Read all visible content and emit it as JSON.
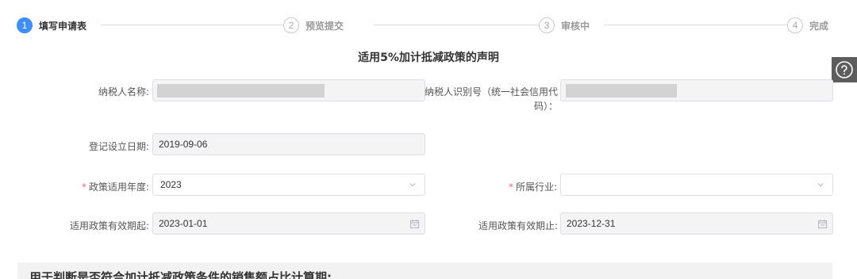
{
  "steps": [
    {
      "num": "1",
      "label": "填写申请表"
    },
    {
      "num": "2",
      "label": "预览提交"
    },
    {
      "num": "3",
      "label": "审核中"
    },
    {
      "num": "4",
      "label": "完成"
    }
  ],
  "title": "适用5%加计抵减政策的声明",
  "help_icon": "question-circle-icon",
  "form": {
    "taxpayer_name_label": "纳税人名称:",
    "taxpayer_id_label_line1": "纳税人识别号（统一社会信用代",
    "taxpayer_id_label_line2": "码）：",
    "reg_date_label": "登记设立日期:",
    "reg_date_value": "2019-09-06",
    "required_mark": "*",
    "policy_year_label": "政策适用年度:",
    "policy_year_value": "2023",
    "industry_label": "所属行业:",
    "industry_value": "",
    "start_label": "适用政策有效期起:",
    "start_value": "2023-01-01",
    "end_label": "适用政策有效期止:",
    "end_value": "2023-12-31"
  },
  "section_title": "用于判断是否符合加计抵减政策条件的销售额占比计算期:"
}
